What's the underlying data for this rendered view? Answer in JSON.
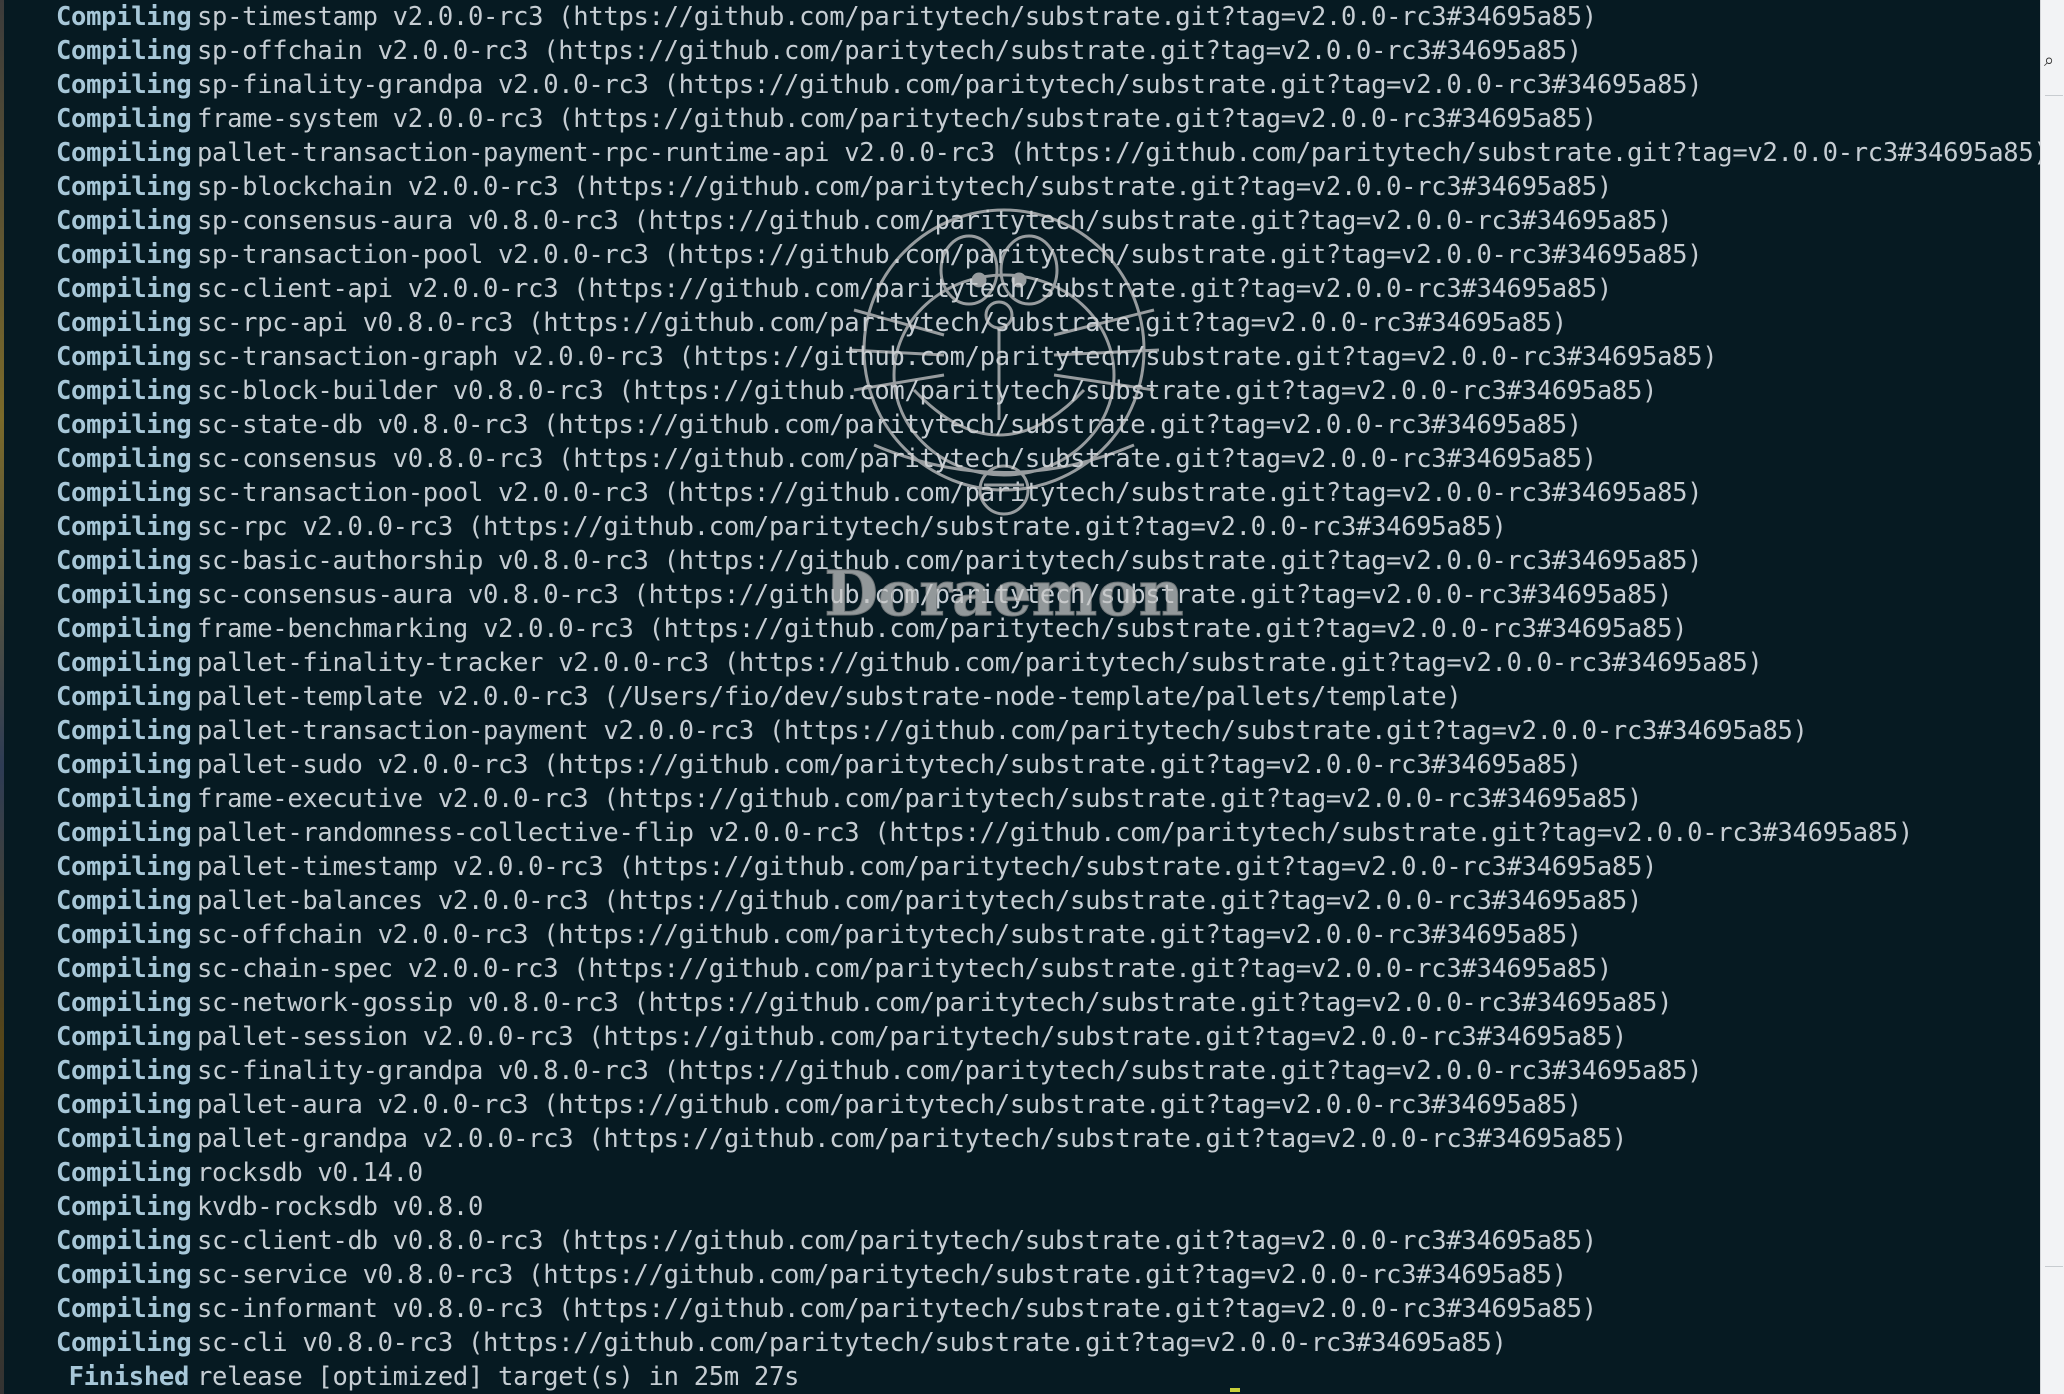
{
  "terminal": {
    "lines": [
      {
        "verb": "Compiling",
        "text": "sp-timestamp v2.0.0-rc3 (https://github.com/paritytech/substrate.git?tag=v2.0.0-rc3#34695a85)"
      },
      {
        "verb": "Compiling",
        "text": "sp-offchain v2.0.0-rc3 (https://github.com/paritytech/substrate.git?tag=v2.0.0-rc3#34695a85)"
      },
      {
        "verb": "Compiling",
        "text": "sp-finality-grandpa v2.0.0-rc3 (https://github.com/paritytech/substrate.git?tag=v2.0.0-rc3#34695a85)"
      },
      {
        "verb": "Compiling",
        "text": "frame-system v2.0.0-rc3 (https://github.com/paritytech/substrate.git?tag=v2.0.0-rc3#34695a85)"
      },
      {
        "verb": "Compiling",
        "text": "pallet-transaction-payment-rpc-runtime-api v2.0.0-rc3 (https://github.com/paritytech/substrate.git?tag=v2.0.0-rc3#34695a85)"
      },
      {
        "verb": "Compiling",
        "text": "sp-blockchain v2.0.0-rc3 (https://github.com/paritytech/substrate.git?tag=v2.0.0-rc3#34695a85)"
      },
      {
        "verb": "Compiling",
        "text": "sp-consensus-aura v0.8.0-rc3 (https://github.com/paritytech/substrate.git?tag=v2.0.0-rc3#34695a85)"
      },
      {
        "verb": "Compiling",
        "text": "sp-transaction-pool v2.0.0-rc3 (https://github.com/paritytech/substrate.git?tag=v2.0.0-rc3#34695a85)"
      },
      {
        "verb": "Compiling",
        "text": "sc-client-api v2.0.0-rc3 (https://github.com/paritytech/substrate.git?tag=v2.0.0-rc3#34695a85)"
      },
      {
        "verb": "Compiling",
        "text": "sc-rpc-api v0.8.0-rc3 (https://github.com/paritytech/substrate.git?tag=v2.0.0-rc3#34695a85)"
      },
      {
        "verb": "Compiling",
        "text": "sc-transaction-graph v2.0.0-rc3 (https://github.com/paritytech/substrate.git?tag=v2.0.0-rc3#34695a85)"
      },
      {
        "verb": "Compiling",
        "text": "sc-block-builder v0.8.0-rc3 (https://github.com/paritytech/substrate.git?tag=v2.0.0-rc3#34695a85)"
      },
      {
        "verb": "Compiling",
        "text": "sc-state-db v0.8.0-rc3 (https://github.com/paritytech/substrate.git?tag=v2.0.0-rc3#34695a85)"
      },
      {
        "verb": "Compiling",
        "text": "sc-consensus v0.8.0-rc3 (https://github.com/paritytech/substrate.git?tag=v2.0.0-rc3#34695a85)"
      },
      {
        "verb": "Compiling",
        "text": "sc-transaction-pool v2.0.0-rc3 (https://github.com/paritytech/substrate.git?tag=v2.0.0-rc3#34695a85)"
      },
      {
        "verb": "Compiling",
        "text": "sc-rpc v2.0.0-rc3 (https://github.com/paritytech/substrate.git?tag=v2.0.0-rc3#34695a85)"
      },
      {
        "verb": "Compiling",
        "text": "sc-basic-authorship v0.8.0-rc3 (https://github.com/paritytech/substrate.git?tag=v2.0.0-rc3#34695a85)"
      },
      {
        "verb": "Compiling",
        "text": "sc-consensus-aura v0.8.0-rc3 (https://github.com/paritytech/substrate.git?tag=v2.0.0-rc3#34695a85)"
      },
      {
        "verb": "Compiling",
        "text": "frame-benchmarking v2.0.0-rc3 (https://github.com/paritytech/substrate.git?tag=v2.0.0-rc3#34695a85)"
      },
      {
        "verb": "Compiling",
        "text": "pallet-finality-tracker v2.0.0-rc3 (https://github.com/paritytech/substrate.git?tag=v2.0.0-rc3#34695a85)"
      },
      {
        "verb": "Compiling",
        "text": "pallet-template v2.0.0-rc3 (/Users/fio/dev/substrate-node-template/pallets/template)"
      },
      {
        "verb": "Compiling",
        "text": "pallet-transaction-payment v2.0.0-rc3 (https://github.com/paritytech/substrate.git?tag=v2.0.0-rc3#34695a85)"
      },
      {
        "verb": "Compiling",
        "text": "pallet-sudo v2.0.0-rc3 (https://github.com/paritytech/substrate.git?tag=v2.0.0-rc3#34695a85)"
      },
      {
        "verb": "Compiling",
        "text": "frame-executive v2.0.0-rc3 (https://github.com/paritytech/substrate.git?tag=v2.0.0-rc3#34695a85)"
      },
      {
        "verb": "Compiling",
        "text": "pallet-randomness-collective-flip v2.0.0-rc3 (https://github.com/paritytech/substrate.git?tag=v2.0.0-rc3#34695a85)"
      },
      {
        "verb": "Compiling",
        "text": "pallet-timestamp v2.0.0-rc3 (https://github.com/paritytech/substrate.git?tag=v2.0.0-rc3#34695a85)"
      },
      {
        "verb": "Compiling",
        "text": "pallet-balances v2.0.0-rc3 (https://github.com/paritytech/substrate.git?tag=v2.0.0-rc3#34695a85)"
      },
      {
        "verb": "Compiling",
        "text": "sc-offchain v2.0.0-rc3 (https://github.com/paritytech/substrate.git?tag=v2.0.0-rc3#34695a85)"
      },
      {
        "verb": "Compiling",
        "text": "sc-chain-spec v2.0.0-rc3 (https://github.com/paritytech/substrate.git?tag=v2.0.0-rc3#34695a85)"
      },
      {
        "verb": "Compiling",
        "text": "sc-network-gossip v0.8.0-rc3 (https://github.com/paritytech/substrate.git?tag=v2.0.0-rc3#34695a85)"
      },
      {
        "verb": "Compiling",
        "text": "pallet-session v2.0.0-rc3 (https://github.com/paritytech/substrate.git?tag=v2.0.0-rc3#34695a85)"
      },
      {
        "verb": "Compiling",
        "text": "sc-finality-grandpa v0.8.0-rc3 (https://github.com/paritytech/substrate.git?tag=v2.0.0-rc3#34695a85)"
      },
      {
        "verb": "Compiling",
        "text": "pallet-aura v2.0.0-rc3 (https://github.com/paritytech/substrate.git?tag=v2.0.0-rc3#34695a85)"
      },
      {
        "verb": "Compiling",
        "text": "pallet-grandpa v2.0.0-rc3 (https://github.com/paritytech/substrate.git?tag=v2.0.0-rc3#34695a85)"
      },
      {
        "verb": "Compiling",
        "text": "rocksdb v0.14.0"
      },
      {
        "verb": "Compiling",
        "text": "kvdb-rocksdb v0.8.0"
      },
      {
        "verb": "Compiling",
        "text": "sc-client-db v0.8.0-rc3 (https://github.com/paritytech/substrate.git?tag=v2.0.0-rc3#34695a85)"
      },
      {
        "verb": "Compiling",
        "text": "sc-service v0.8.0-rc3 (https://github.com/paritytech/substrate.git?tag=v2.0.0-rc3#34695a85)"
      },
      {
        "verb": "Compiling",
        "text": "sc-informant v0.8.0-rc3 (https://github.com/paritytech/substrate.git?tag=v2.0.0-rc3#34695a85)"
      },
      {
        "verb": "Compiling",
        "text": "sc-cli v0.8.0-rc3 (https://github.com/paritytech/substrate.git?tag=v2.0.0-rc3#34695a85)"
      }
    ],
    "finished": {
      "verb": "Finished",
      "text": "release [optimized] target(s) in 25m 27s"
    }
  },
  "watermark": {
    "text": "Doraemon",
    "color": "#c9c9c9"
  },
  "colors": {
    "background": "#061a22",
    "verb": "#a7c7d8",
    "text": "#c6cdd3"
  },
  "icons": {
    "right_panel": "magnifier-icon"
  }
}
